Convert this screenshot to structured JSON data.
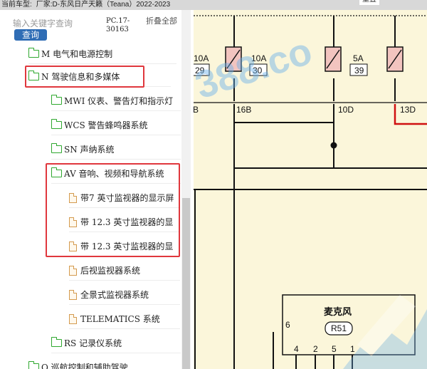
{
  "topbar": {
    "label": "当前车型:",
    "model": "厂家:D-东风日产天籁（Teana）2022-2023",
    "tail": "重置"
  },
  "search": {
    "placeholder": "输入关键字查询",
    "button_label": "查询",
    "code": "PC.17-30163",
    "collapse_all": "折叠全部"
  },
  "tree": {
    "items": [
      {
        "label": "M 电气和电源控制",
        "icon": "folder-icon"
      },
      {
        "label": "N 驾驶信息和多媒体",
        "icon": "folder-icon"
      },
      {
        "label": "MWI 仪表、警告灯和指示灯",
        "icon": "folder-icon"
      },
      {
        "label": "WCS 警告蜂鸣器系统",
        "icon": "folder-icon"
      },
      {
        "label": "SN 声纳系统",
        "icon": "folder-icon"
      },
      {
        "label": "AV 音响、视频和导航系统",
        "icon": "folder-icon"
      },
      {
        "label": "带7 英寸监视器的显示屏",
        "icon": "doc-icon"
      },
      {
        "label": "带 12.3 英寸监视器的显",
        "icon": "doc-icon"
      },
      {
        "label": "带 12.3 英寸监视器的显",
        "icon": "doc-icon"
      },
      {
        "label": "后视监视器系统",
        "icon": "doc-icon"
      },
      {
        "label": "全景式监视器系统",
        "icon": "doc-icon"
      },
      {
        "label": "TELEMATICS 系统",
        "icon": "doc-icon"
      },
      {
        "label": "RS 记录仪系统",
        "icon": "folder-icon"
      },
      {
        "label": "O 巡航控制和辅助驾驶",
        "icon": "folder-icon"
      }
    ]
  },
  "diagram": {
    "fuses": [
      {
        "rating": "10A",
        "number": "29"
      },
      {
        "rating": "10A",
        "number": "30"
      },
      {
        "rating": "5A",
        "number": "39"
      }
    ],
    "connectors": [
      "B",
      "16B",
      "10D",
      "13D"
    ],
    "component_name": "麦克风",
    "component_code": "R51",
    "pins": [
      "6",
      "4",
      "2",
      "5",
      "1"
    ],
    "watermark": "388.co"
  },
  "colors": {
    "highlight": "#e0373d",
    "diagram_bg": "#fbf6da",
    "relay_fill": "#f2c4bf",
    "wire_red": "#d01010",
    "watermark": "#6ab0ea",
    "search_button": "#2f6db5"
  }
}
